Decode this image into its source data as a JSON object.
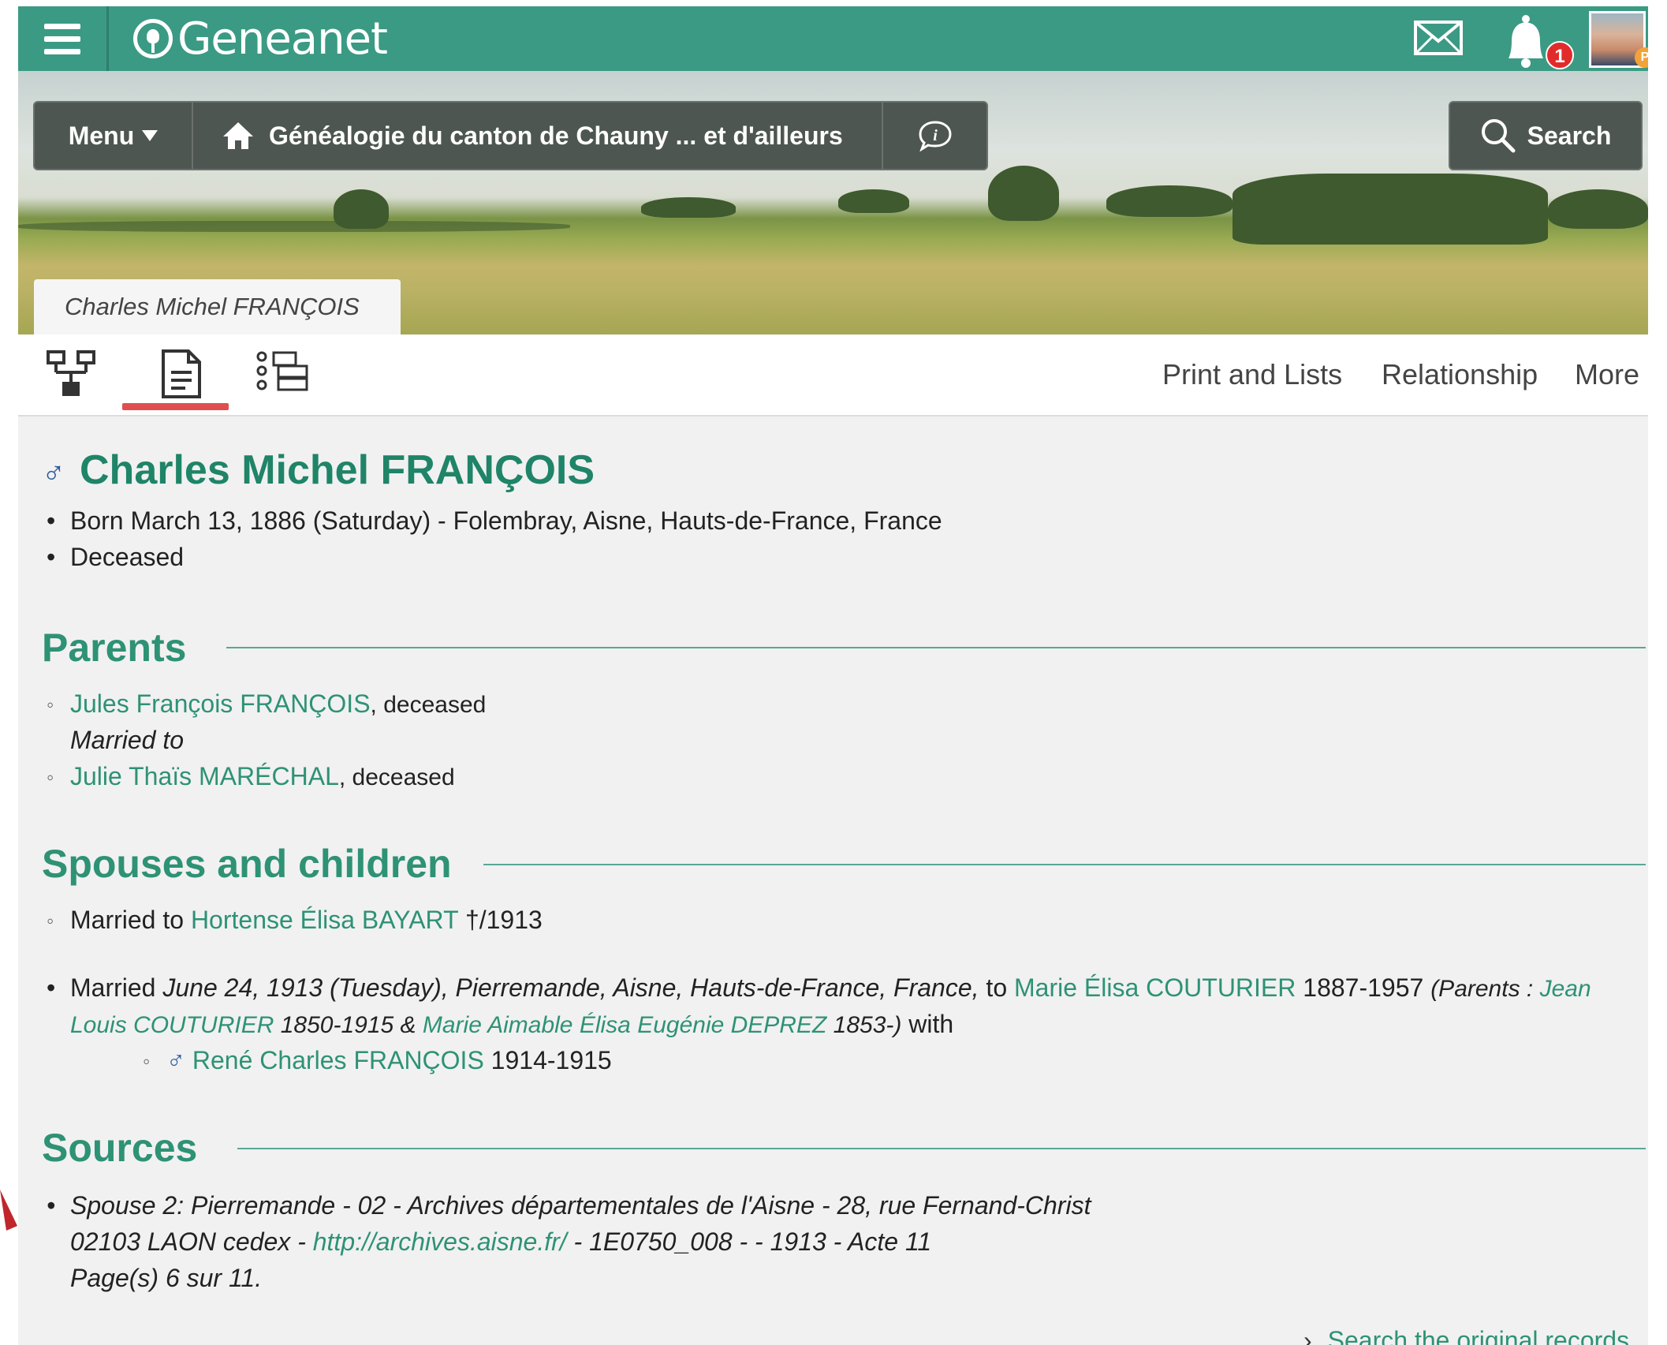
{
  "topbar": {
    "brand": "Geneanet",
    "notification_count": "1",
    "premium_badge": "P"
  },
  "banner": {
    "menu_label": "Menu",
    "site_title": "Généalogie du canton de Chauny ... et d'ailleurs",
    "search_label": "Search",
    "person_tab": "Charles Michel FRANÇOIS"
  },
  "tabs": {
    "icons": [
      "family-tree-icon",
      "individual-sheet-icon",
      "list-view-icon"
    ],
    "links": {
      "print": "Print and Lists",
      "relationship": "Relationship",
      "more": "More"
    }
  },
  "person": {
    "gender_symbol": "♂",
    "name": "Charles Michel FRANÇOIS",
    "born": "Born March 13, 1886 (Saturday) - Folembray, Aisne, Hauts-de-France, France",
    "status": "Deceased"
  },
  "parents": {
    "heading": "Parents",
    "father_name": "Jules François FRANÇOIS",
    "father_status": ", deceased",
    "married_to": "Married to",
    "mother_name": "Julie Thaïs MARÉCHAL",
    "mother_status": ", deceased"
  },
  "spouses": {
    "heading": "Spouses and children",
    "spouse1_prefix": "Married to ",
    "spouse1_name": "Hortense Élisa BAYART",
    "spouse1_suffix": " †/1913",
    "spouse2_prefix": "Married ",
    "spouse2_details": "June 24, 1913 (Tuesday), Pierremande, Aisne, Hauts-de-France, France,",
    "spouse2_to": " to ",
    "spouse2_name": "Marie Élisa COUTURIER",
    "spouse2_dates": " 1887-1957 ",
    "parents_label": "(Parents : ",
    "parent1_line1": "Jean",
    "parent1_line2": "Louis COUTURIER",
    "parent1_dates": " 1850-1915 & ",
    "parent2_name": "Marie Aimable Élisa Eugénie DEPREZ",
    "parent2_dates": " 1853-)",
    "with": " with",
    "child_symbol": "♂",
    "child_name": "René Charles FRANÇOIS",
    "child_dates": " 1914-1915"
  },
  "sources": {
    "heading": "Sources",
    "line1": "Spouse 2: Pierremande - 02 - Archives départementales de l'Aisne - 28, rue Fernand-Christ",
    "line2_pre": "02103 LAON cedex - ",
    "line2_link": "http://archives.aisne.fr/",
    "line2_post": " - 1E0750_008 - - 1913 - Acte 11",
    "line3": "Page(s) 6 sur 11.",
    "search_records": "Search the original records"
  },
  "colors": {
    "brand_green": "#3b9a84",
    "link_green": "#2e9275",
    "heading_green": "#1f8468",
    "tab_underline": "#e04f4f",
    "notification": "#e12b2b"
  }
}
